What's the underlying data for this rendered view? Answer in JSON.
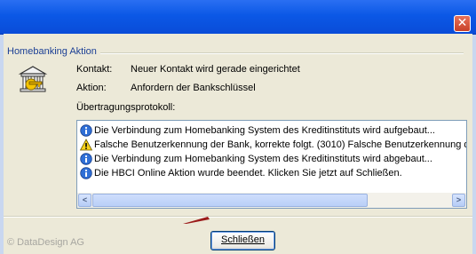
{
  "window": {
    "close_glyph": "✕"
  },
  "group": {
    "title": "Homebanking Aktion"
  },
  "fields": {
    "kontakt_label": "Kontakt:",
    "kontakt_value": "Neuer Kontakt wird gerade eingerichtet",
    "aktion_label": "Aktion:",
    "aktion_value": "Anfordern der Bankschlüssel",
    "protocol_label": "Übertragungsprotokoll:"
  },
  "log": [
    {
      "icon": "info-icon",
      "text": "Die Verbindung zum Homebanking System des Kreditinstituts wird aufgebaut..."
    },
    {
      "icon": "warning-icon",
      "text": "Falsche Benutzerkennung der Bank, korrekte folgt. (3010)  Falsche Benutzerkennung d"
    },
    {
      "icon": "info-icon",
      "text": "Die Verbindung zum Homebanking System des Kreditinstituts wird abgebaut..."
    },
    {
      "icon": "info-icon",
      "text": "Die HBCI Online Aktion wurde beendet. Klicken Sie jetzt auf Schließen."
    }
  ],
  "footer": {
    "copyright": "© DataDesign AG",
    "close_button": "Schließen"
  },
  "colors": {
    "titlebar": "#0b58e6",
    "dialog_bg": "#ece9d8",
    "group_title": "#1b3f95"
  }
}
